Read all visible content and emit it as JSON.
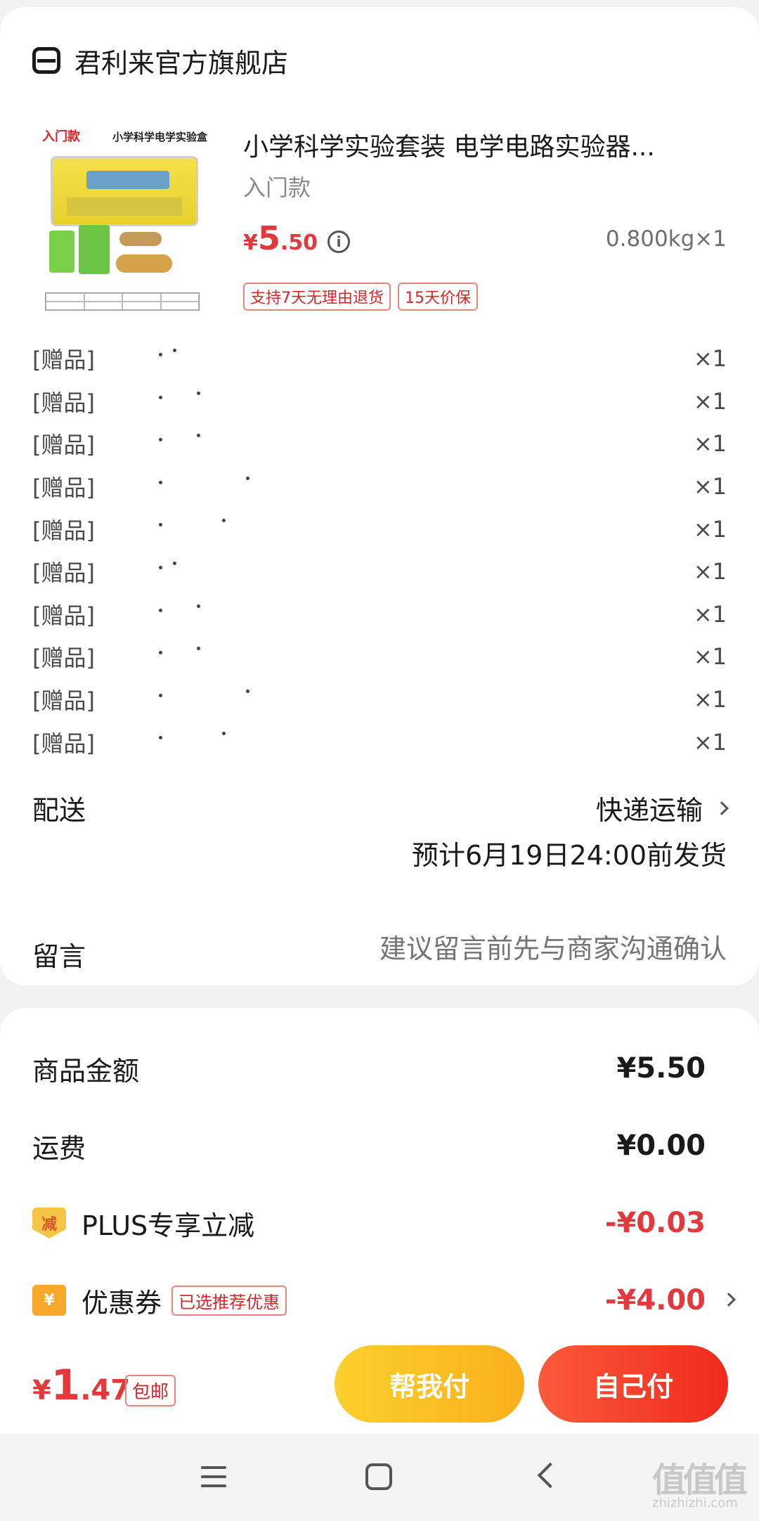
{
  "shop": {
    "name": "君利来官方旗舰店",
    "icon": "shop-icon"
  },
  "product": {
    "image_label_title": "入门款",
    "image_label_sub": "小学科学电学实验盒",
    "title": "小学科学实验套装 电学电路实验器...",
    "variant": "入门款",
    "price": {
      "currency": "¥",
      "int": "5",
      "dec": ".50"
    },
    "weight_qty": "0.800kg×1",
    "tags": [
      "支持7天无理由退货",
      "15天价保"
    ]
  },
  "gifts": [
    {
      "label": "[赠品]",
      "qty": "×1"
    },
    {
      "label": "[赠品]",
      "qty": "×1"
    },
    {
      "label": "[赠品]",
      "qty": "×1"
    },
    {
      "label": "[赠品]",
      "qty": "×1"
    },
    {
      "label": "[赠品]",
      "qty": "×1"
    },
    {
      "label": "[赠品]",
      "qty": "×1"
    },
    {
      "label": "[赠品]",
      "qty": "×1"
    },
    {
      "label": "[赠品]",
      "qty": "×1"
    },
    {
      "label": "[赠品]",
      "qty": "×1"
    },
    {
      "label": "[赠品]",
      "qty": "×1"
    }
  ],
  "delivery": {
    "label": "配送",
    "method": "快递运输",
    "eta": "预计6月19日24:00前发货"
  },
  "message": {
    "label": "留言",
    "placeholder": "建议留言前先与商家沟通确认"
  },
  "summary": {
    "goods_label": "商品金额",
    "goods_value": "¥5.50",
    "shipping_label": "运费",
    "shipping_value": "¥0.00",
    "plus_badge": "减",
    "plus_label": "PLUS专享立减",
    "plus_value": "-¥0.03",
    "coupon_badge": "¥",
    "coupon_label": "优惠券",
    "coupon_tag": "已选推荐优惠",
    "coupon_value": "-¥4.00"
  },
  "footer": {
    "total": {
      "currency": "¥",
      "int": "1",
      "dec": ".47"
    },
    "free_shipping": "包邮",
    "help_pay": "帮我付",
    "self_pay": "自己付"
  },
  "watermark": {
    "main": "值值值",
    "sub": "zhizhizhi.com"
  },
  "colors": {
    "accent_red": "#e4393c",
    "help_btn": "#fbd02c",
    "self_btn": "#ef2a1c"
  }
}
